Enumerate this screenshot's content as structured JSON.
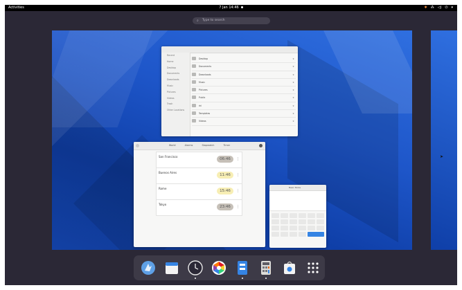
{
  "topbar": {
    "activities": "Activities",
    "clock": "7 Jan  14:46"
  },
  "search": {
    "placeholder": "Type to search"
  },
  "files": {
    "sidebar": [
      "Recent",
      "Home",
      "Desktop",
      "Documents",
      "Downloads",
      "Music",
      "Pictures",
      "Videos",
      "Trash",
      "Other Locations"
    ],
    "rows": [
      {
        "name": "Desktop",
        "size": "",
        "date": "",
        "starred": "★"
      },
      {
        "name": "Documents",
        "size": "",
        "date": "",
        "starred": "★"
      },
      {
        "name": "Downloads",
        "size": "",
        "date": "",
        "starred": "★"
      },
      {
        "name": "Music",
        "size": "",
        "date": "",
        "starred": "★"
      },
      {
        "name": "Pictures",
        "size": "",
        "date": "",
        "starred": "★"
      },
      {
        "name": "Public",
        "size": "",
        "date": "",
        "starred": "★"
      },
      {
        "name": "rhl",
        "size": "",
        "date": "",
        "starred": "★"
      },
      {
        "name": "Templates",
        "size": "",
        "date": "",
        "starred": "★"
      },
      {
        "name": "Videos",
        "size": "",
        "date": "",
        "starred": "★"
      }
    ]
  },
  "clocks": {
    "tabs": [
      "World",
      "Alarms",
      "Stopwatch",
      "Timer"
    ],
    "items": [
      {
        "city": "San Francisco",
        "sub": "",
        "time": "06:46",
        "bg": "#c6c0b8"
      },
      {
        "city": "Buenos Aires",
        "sub": "",
        "time": "11:46",
        "bg": "#f7eeb4"
      },
      {
        "city": "Rome",
        "sub": "",
        "time": "15:46",
        "bg": "#f7eeb4"
      },
      {
        "city": "Tokyo",
        "sub": "",
        "time": "23:46",
        "bg": "#c6c0b8"
      }
    ]
  },
  "calculator": {
    "title": "Basic Mode"
  },
  "dock": {
    "apps": [
      {
        "name": "web-browser-icon"
      },
      {
        "name": "calendar-app-icon"
      },
      {
        "name": "clocks-app-icon"
      },
      {
        "name": "photos-app-icon"
      },
      {
        "name": "files-app-icon"
      },
      {
        "name": "calculator-app-icon"
      },
      {
        "name": "software-app-icon"
      },
      {
        "name": "show-applications-icon"
      }
    ]
  },
  "colors": {
    "accent": "#3584e4",
    "panel": "#000000",
    "overview_bg": "#2b2836"
  }
}
